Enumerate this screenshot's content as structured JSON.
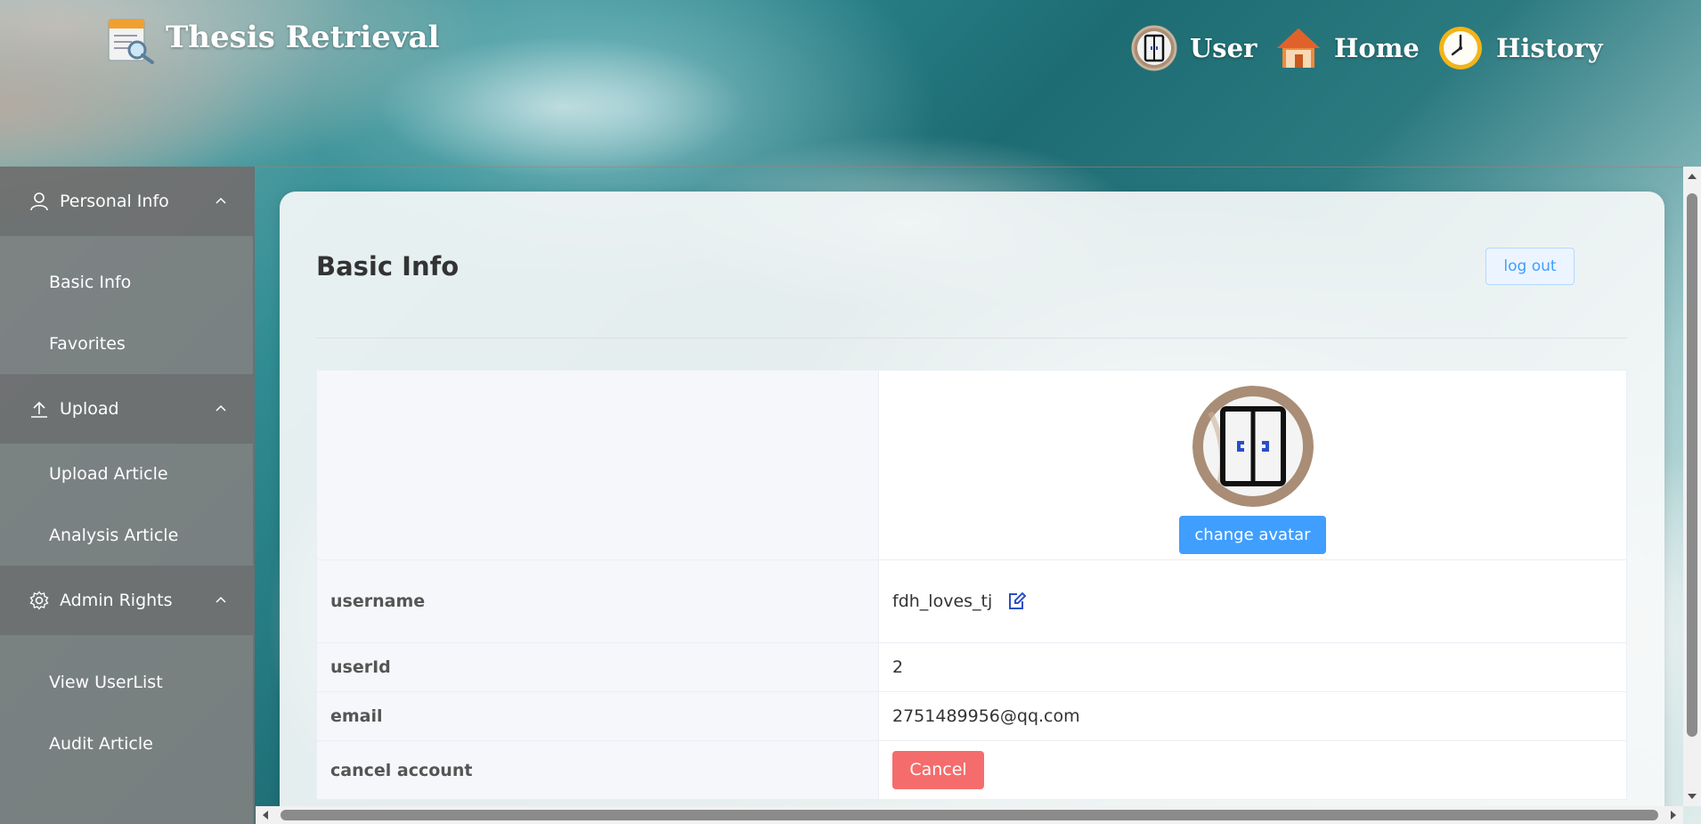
{
  "header": {
    "app_title": "Thesis Retrieval",
    "logo_icon": "document-search-icon",
    "nav": [
      {
        "label": "User",
        "icon": "door-icon"
      },
      {
        "label": "Home",
        "icon": "house-icon"
      },
      {
        "label": "History",
        "icon": "clock-icon"
      }
    ]
  },
  "sidebar": {
    "groups": [
      {
        "label": "Personal Info",
        "icon": "user-icon",
        "items": [
          {
            "label": "Basic Info"
          },
          {
            "label": "Favorites"
          }
        ]
      },
      {
        "label": "Upload",
        "icon": "upload-icon",
        "items": [
          {
            "label": "Upload Article"
          },
          {
            "label": "Analysis Article"
          }
        ]
      },
      {
        "label": "Admin Rights",
        "icon": "gear-icon",
        "items": [
          {
            "label": "View UserList"
          },
          {
            "label": "Audit Article"
          }
        ]
      }
    ]
  },
  "main": {
    "title": "Basic Info",
    "logout_label": "log out",
    "change_avatar_label": "change avatar",
    "rows": {
      "username": {
        "label": "username",
        "value": "fdh_loves_tj"
      },
      "userid": {
        "label": "userId",
        "value": "2"
      },
      "email": {
        "label": "email",
        "value": "2751489956@qq.com"
      },
      "cancel": {
        "label": "cancel account",
        "button": "Cancel"
      }
    }
  },
  "colors": {
    "primary": "#409eff",
    "danger": "#f56c6c",
    "sidebar": "#808080"
  }
}
